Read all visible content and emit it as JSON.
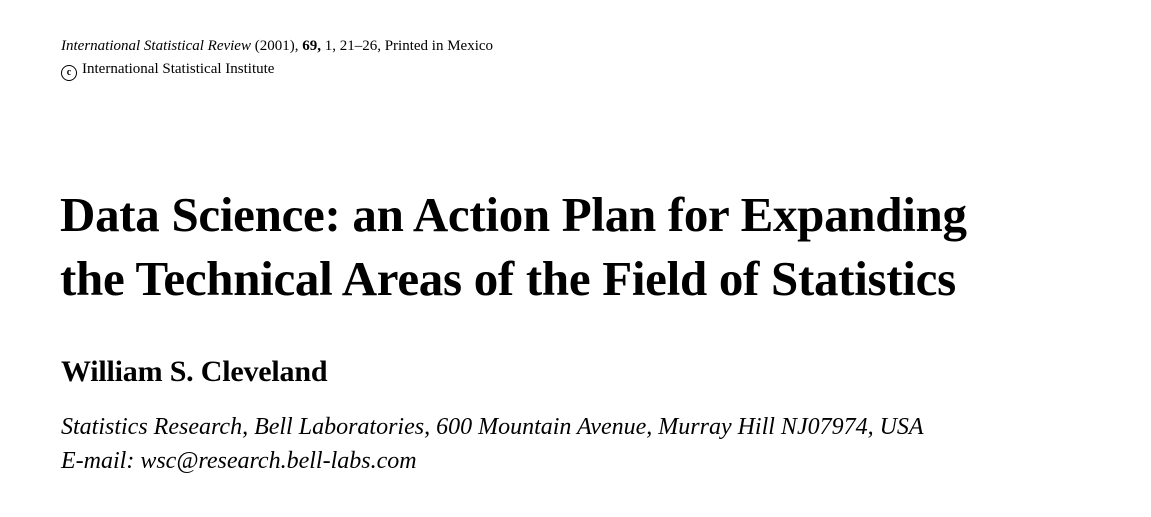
{
  "header": {
    "journal_name": "International Statistical Review",
    "year": "(2001),",
    "volume": "69,",
    "pages_info": "1, 21–26, Printed in Mexico",
    "copyright_symbol": "c",
    "copyright_holder": "International Statistical Institute"
  },
  "article": {
    "title_line_1": "Data Science: an Action Plan for Expanding",
    "title_line_2": "the Technical Areas of the Field of Statistics",
    "author": "William S. Cleveland",
    "affiliation": "Statistics Research, Bell Laboratories, 600 Mountain Avenue, Murray Hill NJ07974, USA",
    "email": "E-mail: wsc@research.bell-labs.com"
  }
}
